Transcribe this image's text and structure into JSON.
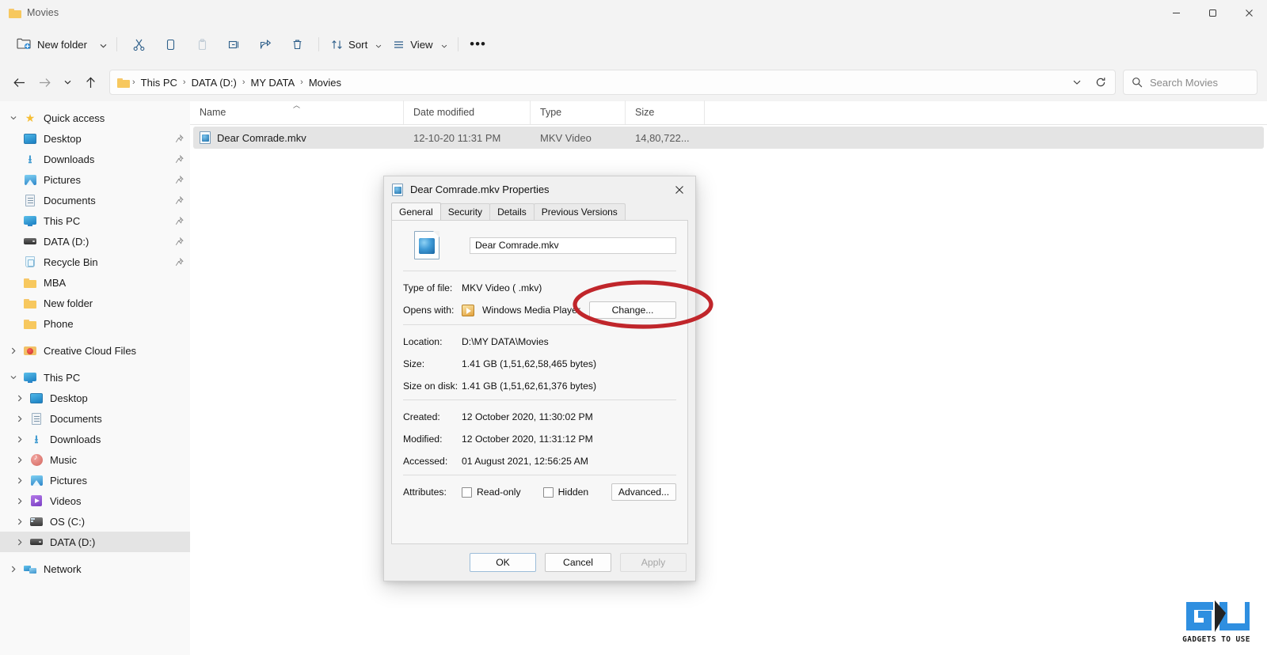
{
  "window": {
    "title": "Movies",
    "folder_icon": "folder-icon",
    "controls": {
      "minimize": "minimize-icon",
      "maximize": "maximize-icon",
      "close": "close-icon"
    }
  },
  "toolbar": {
    "new_folder_label": "New folder",
    "new_folder_caret": "chevron-down-icon",
    "icons": [
      {
        "name": "cut-icon",
        "label": "Cut",
        "disabled": false
      },
      {
        "name": "copy-icon",
        "label": "Copy",
        "disabled": false
      },
      {
        "name": "paste-icon",
        "label": "Paste",
        "disabled": true
      },
      {
        "name": "rename-icon",
        "label": "Rename",
        "disabled": false
      },
      {
        "name": "share-icon",
        "label": "Share",
        "disabled": false
      },
      {
        "name": "delete-icon",
        "label": "Delete",
        "disabled": false
      }
    ],
    "sort_label": "Sort",
    "view_label": "View",
    "more_label": "•••"
  },
  "address": {
    "back": "back-arrow-icon",
    "forward": "forward-arrow-icon",
    "recent": "chevron-down-icon",
    "up": "up-arrow-icon",
    "breadcrumbs": [
      "This PC",
      "DATA (D:)",
      "MY DATA",
      "Movies"
    ],
    "separator": "›",
    "dropdown": "chevron-down-icon",
    "refresh": "refresh-icon"
  },
  "search": {
    "placeholder": "Search Movies",
    "icon": "search-icon"
  },
  "sidebar": {
    "groups": [
      {
        "name": "Quick access",
        "icon": "star-icon",
        "expanded": true,
        "items": [
          {
            "label": "Desktop",
            "icon": "desktop-icon",
            "pinned": true
          },
          {
            "label": "Downloads",
            "icon": "downloads-icon",
            "pinned": true
          },
          {
            "label": "Pictures",
            "icon": "pictures-icon",
            "pinned": true
          },
          {
            "label": "Documents",
            "icon": "documents-icon",
            "pinned": true
          },
          {
            "label": "This PC",
            "icon": "this-pc-icon",
            "pinned": true
          },
          {
            "label": "DATA (D:)",
            "icon": "drive-icon",
            "pinned": true
          },
          {
            "label": "Recycle Bin",
            "icon": "recycle-bin-icon",
            "pinned": true
          },
          {
            "label": "MBA",
            "icon": "folder-icon",
            "pinned": false
          },
          {
            "label": "New folder",
            "icon": "folder-icon",
            "pinned": false
          },
          {
            "label": "Phone",
            "icon": "folder-icon",
            "pinned": false
          }
        ]
      },
      {
        "name": "Creative Cloud Files",
        "icon": "creative-cloud-icon",
        "expanded": false,
        "items": []
      },
      {
        "name": "This PC",
        "icon": "this-pc-icon",
        "expanded": true,
        "items": [
          {
            "label": "Desktop",
            "icon": "desktop-icon",
            "pinned": false
          },
          {
            "label": "Documents",
            "icon": "documents-icon",
            "pinned": false
          },
          {
            "label": "Downloads",
            "icon": "downloads-icon",
            "pinned": false
          },
          {
            "label": "Music",
            "icon": "music-icon",
            "pinned": false
          },
          {
            "label": "Pictures",
            "icon": "pictures-icon",
            "pinned": false
          },
          {
            "label": "Videos",
            "icon": "videos-icon",
            "pinned": false
          },
          {
            "label": "OS (C:)",
            "icon": "drive-c-icon",
            "pinned": false
          },
          {
            "label": "DATA (D:)",
            "icon": "drive-icon",
            "pinned": false,
            "selected": true
          }
        ]
      },
      {
        "name": "Network",
        "icon": "network-icon",
        "expanded": false,
        "items": []
      }
    ]
  },
  "filelist": {
    "columns": [
      "Name",
      "Date modified",
      "Type",
      "Size"
    ],
    "sort_column": "Name",
    "sort_direction": "ascending",
    "rows": [
      {
        "name": "Dear Comrade.mkv",
        "date_modified": "12-10-20 11:31 PM",
        "type": "MKV Video",
        "size": "14,80,722...",
        "icon": "mkv-file-icon",
        "selected": true
      }
    ]
  },
  "dialog": {
    "title": "Dear Comrade.mkv Properties",
    "icon": "mkv-file-icon",
    "close": "close-icon",
    "tabs": [
      {
        "label": "General",
        "active": true
      },
      {
        "label": "Security",
        "active": false
      },
      {
        "label": "Details",
        "active": false
      },
      {
        "label": "Previous Versions",
        "active": false
      }
    ],
    "filename_value": "Dear Comrade.mkv",
    "fields": [
      {
        "label": "Type of file:",
        "value": "MKV Video ( .mkv)"
      }
    ],
    "opens_with": {
      "label": "Opens with:",
      "app": "Windows Media Player",
      "app_icon": "windows-media-player-icon",
      "change_button": "Change..."
    },
    "info_fields": [
      {
        "label": "Location:",
        "value": "D:\\MY DATA\\Movies"
      },
      {
        "label": "Size:",
        "value": "1.41 GB (1,51,62,58,465 bytes)"
      },
      {
        "label": "Size on disk:",
        "value": "1.41 GB (1,51,62,61,376 bytes)"
      }
    ],
    "date_fields": [
      {
        "label": "Created:",
        "value": "12 October 2020, 11:30:02 PM"
      },
      {
        "label": "Modified:",
        "value": "12 October 2020, 11:31:12 PM"
      },
      {
        "label": "Accessed:",
        "value": "01 August 2021, 12:56:25 AM"
      }
    ],
    "attributes": {
      "label": "Attributes:",
      "readonly_label": "Read-only",
      "readonly_checked": false,
      "hidden_label": "Hidden",
      "hidden_checked": false,
      "advanced_button": "Advanced..."
    },
    "footer": {
      "ok": "OK",
      "cancel": "Cancel",
      "apply": "Apply",
      "apply_disabled": true
    }
  },
  "annotation": {
    "shape": "ellipse",
    "color": "#c0262b",
    "target": "Change... button"
  },
  "watermark": {
    "text": "GADGETS TO USE",
    "accent_color": "#2f8fe0",
    "dark_color": "#1b1b1b"
  }
}
